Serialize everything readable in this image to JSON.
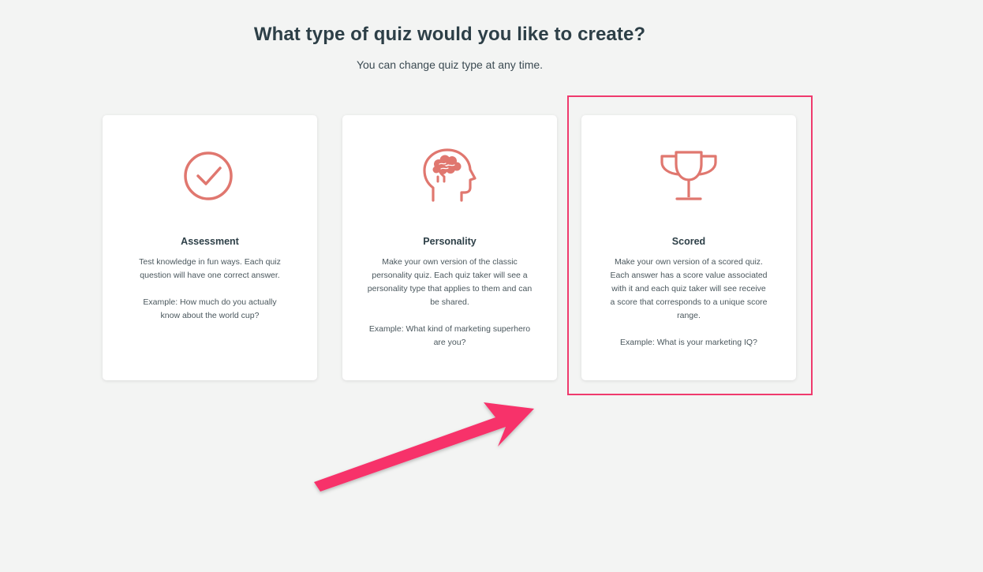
{
  "header": {
    "title": "What type of quiz would you like to create?",
    "subtitle": "You can change quiz type at any time."
  },
  "quiz_types": [
    {
      "icon": "checkmark-circle-icon",
      "title": "Assessment",
      "description": "Test knowledge in fun ways. Each quiz question will have one correct answer.",
      "example": "Example: How much do you actually know about the world cup?"
    },
    {
      "icon": "brain-head-icon",
      "title": "Personality",
      "description": "Make your own version of the classic personality quiz. Each quiz taker will see a personality type that applies to them and can be shared.",
      "example": "Example: What kind of marketing superhero are you?"
    },
    {
      "icon": "trophy-icon",
      "title": "Scored",
      "description": "Make your own version of a scored quiz. Each answer has a score value associated with it and each quiz taker will see receive a score that corresponds to a unique score range.",
      "example": "Example: What is your marketing IQ?"
    }
  ],
  "annotation": {
    "highlight_color": "#ef3a6d",
    "highlighted_card": "Scored"
  },
  "colors": {
    "icon": "#e0776f",
    "background": "#f3f4f3",
    "heading": "#2d3f47"
  }
}
